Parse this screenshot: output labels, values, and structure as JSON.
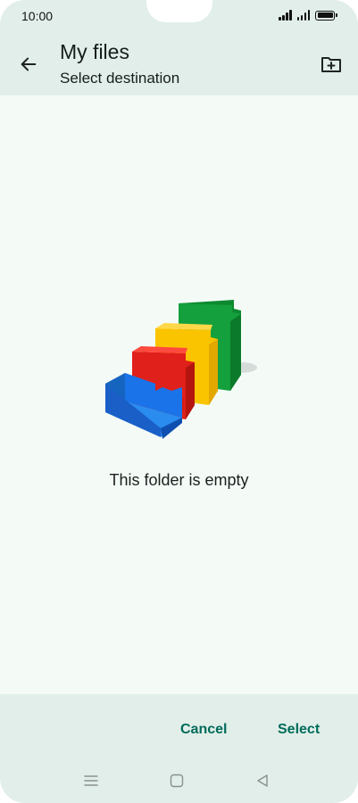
{
  "status_bar": {
    "time": "10:00",
    "icons": [
      "signal-icon",
      "signal-icon",
      "battery-icon"
    ]
  },
  "header": {
    "title": "My files",
    "subtitle": "Select destination",
    "back_icon": "arrow-left-icon",
    "action_icon": "new-folder-icon"
  },
  "main": {
    "empty_message": "This folder is empty",
    "illustration": "empty-folders-illustration"
  },
  "actions": {
    "cancel_label": "Cancel",
    "select_label": "Select"
  },
  "navigation": {
    "icons": [
      "menu-icon",
      "home-square-icon",
      "back-triangle-icon"
    ]
  },
  "colors": {
    "surface": "#f4fbf7",
    "bar_background": "#e1eee9",
    "accent": "#006b5a",
    "folder_blue": "#1a73e8",
    "folder_red": "#e0201a",
    "folder_yellow": "#fbc400",
    "folder_green": "#14a03c"
  }
}
